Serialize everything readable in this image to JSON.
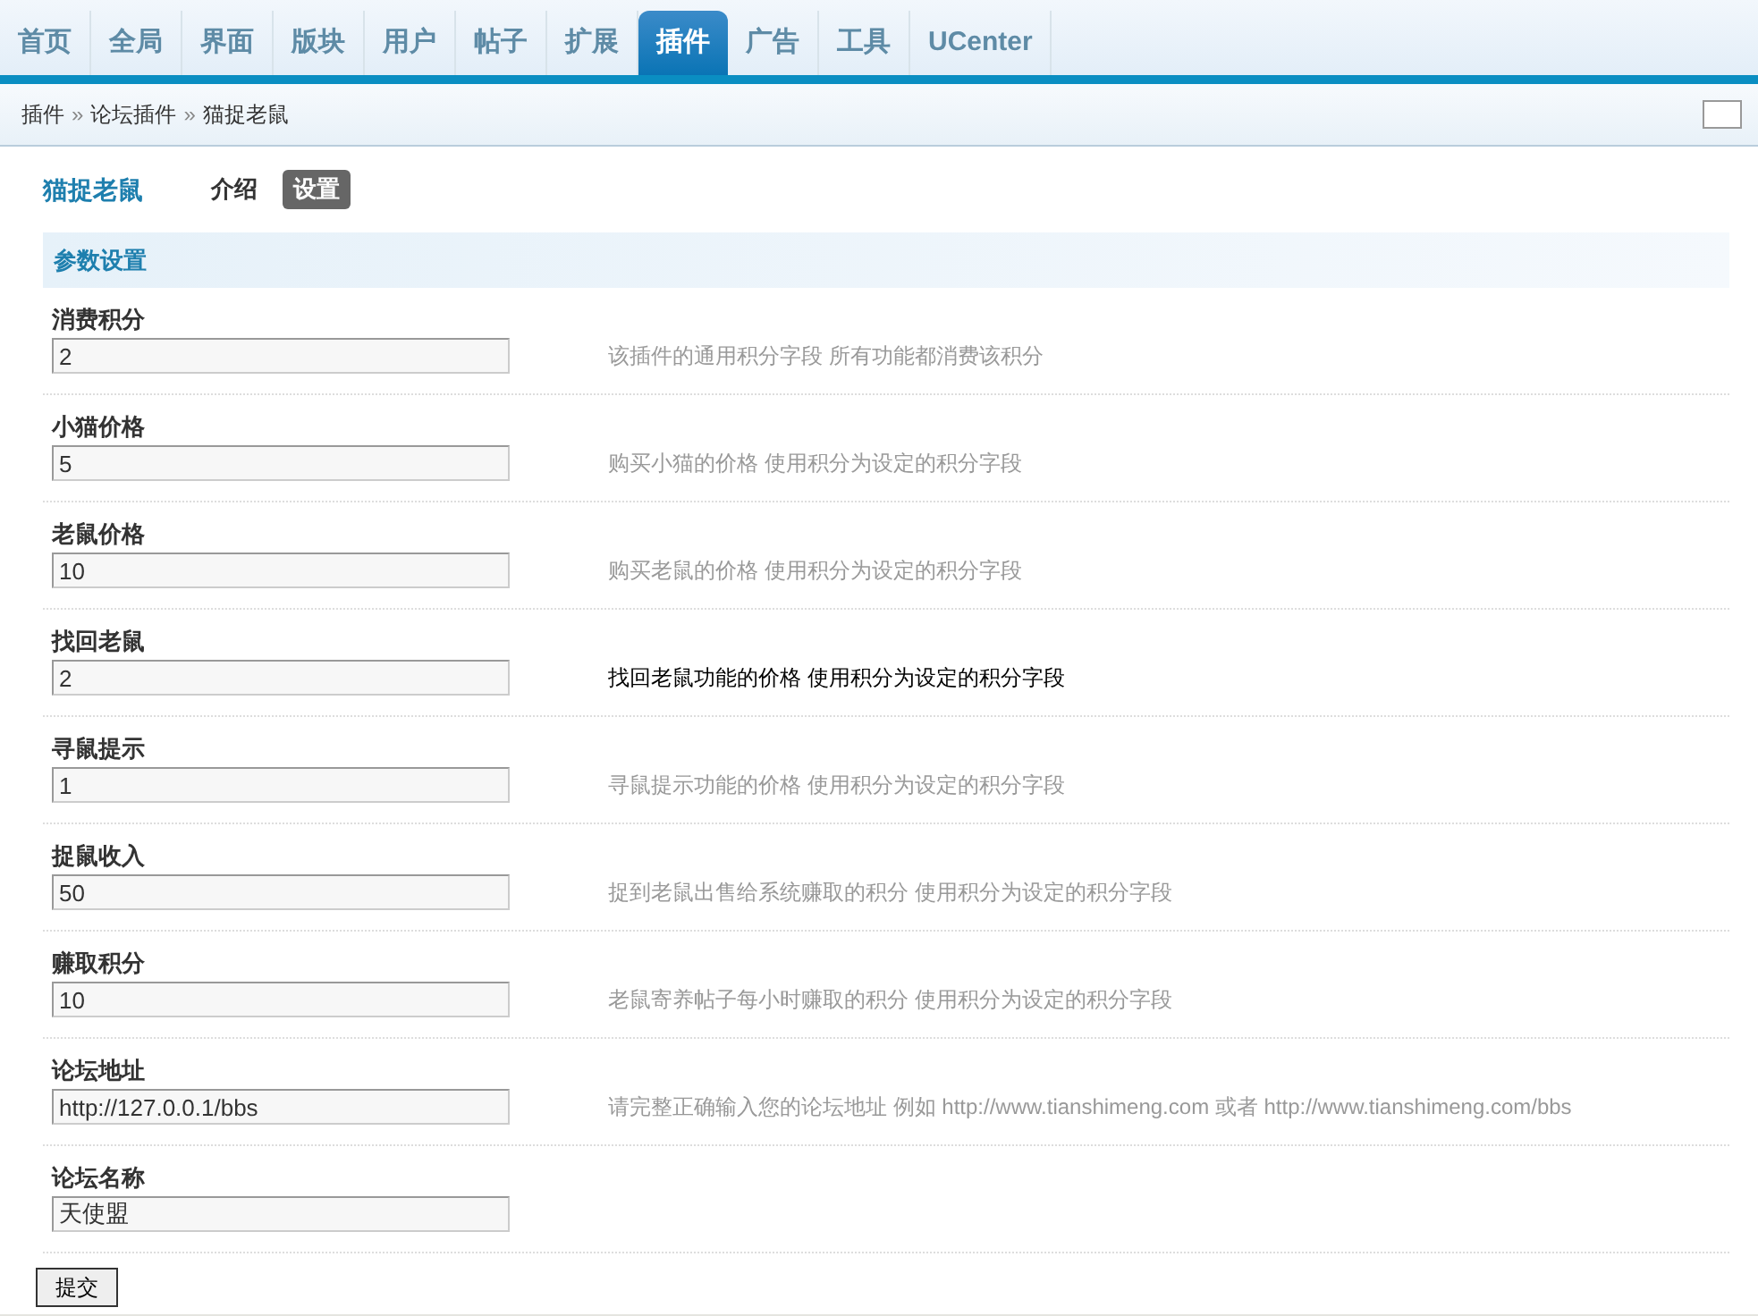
{
  "nav_tabs": [
    {
      "label": "首页",
      "selected": false
    },
    {
      "label": "全局",
      "selected": false
    },
    {
      "label": "界面",
      "selected": false
    },
    {
      "label": "版块",
      "selected": false
    },
    {
      "label": "用户",
      "selected": false
    },
    {
      "label": "帖子",
      "selected": false
    },
    {
      "label": "扩展",
      "selected": false
    },
    {
      "label": "插件",
      "selected": true
    },
    {
      "label": "广告",
      "selected": false
    },
    {
      "label": "工具",
      "selected": false
    },
    {
      "label": "UCenter",
      "selected": false
    }
  ],
  "breadcrumb": [
    "插件",
    "论坛插件",
    "猫捉老鼠"
  ],
  "breadcrumb_separators": [
    "»",
    "»"
  ],
  "plugin": {
    "title": "猫捉老鼠",
    "tabs": [
      {
        "label": "介绍",
        "selected": false
      },
      {
        "label": "设置",
        "selected": true
      }
    ]
  },
  "section": {
    "title": "参数设置"
  },
  "settings": [
    {
      "label": "消费积分",
      "value": "2",
      "hint": "该插件的通用积分字段  所有功能都消费该积分",
      "highlighted": false
    },
    {
      "label": "小猫价格",
      "value": "5",
      "hint": "购买小猫的价格  使用积分为设定的积分字段",
      "highlighted": false
    },
    {
      "label": "老鼠价格",
      "value": "10",
      "hint": "购买老鼠的价格  使用积分为设定的积分字段",
      "highlighted": false
    },
    {
      "label": "找回老鼠",
      "value": "2",
      "hint": "找回老鼠功能的价格  使用积分为设定的积分字段",
      "highlighted": true
    },
    {
      "label": "寻鼠提示",
      "value": "1",
      "hint": "寻鼠提示功能的价格  使用积分为设定的积分字段",
      "highlighted": false
    },
    {
      "label": "捉鼠收入",
      "value": "50",
      "hint": "捉到老鼠出售给系统赚取的积分  使用积分为设定的积分字段",
      "highlighted": false
    },
    {
      "label": "赚取积分",
      "value": "10",
      "hint": "老鼠寄养帖子每小时赚取的积分  使用积分为设定的积分字段",
      "highlighted": false
    },
    {
      "label": "论坛地址",
      "value": "http://127.0.0.1/bbs",
      "hint": "请完整正确输入您的论坛地址  例如  http://www.tianshimeng.com 或者  http://www.tianshimeng.com/bbs",
      "highlighted": false
    },
    {
      "label": "论坛名称",
      "value": "天使盟"
    }
  ],
  "submit_button": "提交"
}
